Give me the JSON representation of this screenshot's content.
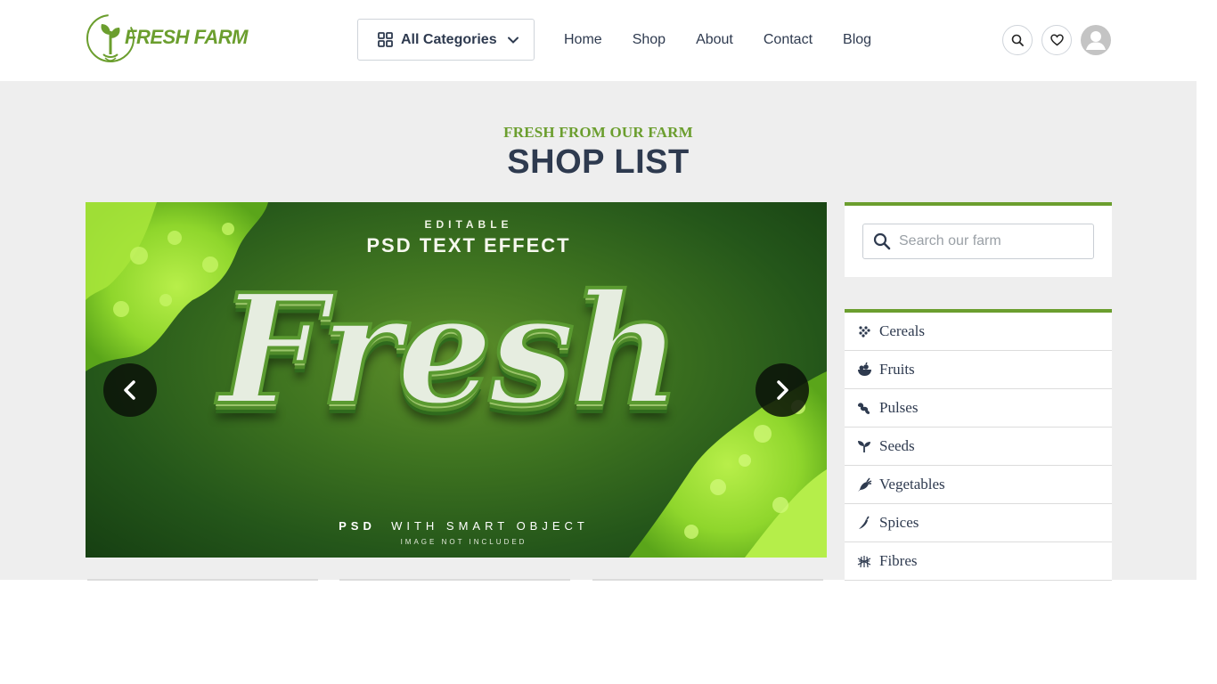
{
  "brand": {
    "name": "FRESH FARM",
    "color": "#6b9e2e"
  },
  "header": {
    "categories_button": {
      "label": "All Categories",
      "icon": "grid-icon"
    },
    "nav": [
      {
        "label": "Home"
      },
      {
        "label": "Shop"
      },
      {
        "label": "About"
      },
      {
        "label": "Contact"
      },
      {
        "label": "Blog"
      }
    ],
    "icons": [
      "search-icon",
      "heart-icon",
      "user-avatar-icon"
    ]
  },
  "hero": {
    "kicker": "FRESH FROM OUR FARM",
    "title": "SHOP LIST"
  },
  "banner": {
    "editable": "EDITABLE",
    "effect": "PSD TEXT EFFECT",
    "headline": "Fresh",
    "psd_bold": "PSD",
    "psd_rest": "WITH SMART OBJECT",
    "not_included": "IMAGE NOT INCLUDED"
  },
  "sidebar": {
    "search": {
      "placeholder": "Search our farm"
    },
    "categories": [
      {
        "label": "Cereals",
        "icon": "cereals-icon"
      },
      {
        "label": "Fruits",
        "icon": "fruits-icon"
      },
      {
        "label": "Pulses",
        "icon": "pulses-icon"
      },
      {
        "label": "Seeds",
        "icon": "seeds-icon"
      },
      {
        "label": "Vegetables",
        "icon": "vegetables-icon"
      },
      {
        "label": "Spices",
        "icon": "spices-icon"
      },
      {
        "label": "Fibres",
        "icon": "fibres-icon"
      }
    ]
  }
}
